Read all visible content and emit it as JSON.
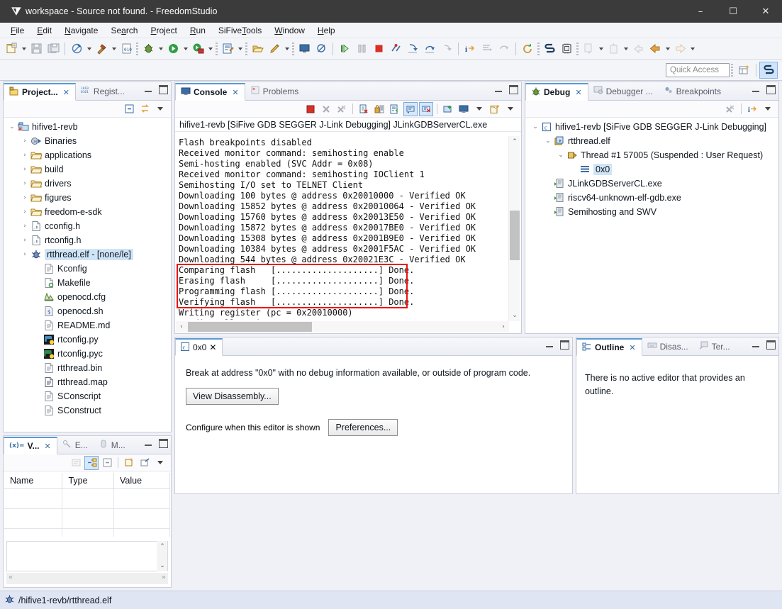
{
  "window": {
    "title": "workspace - Source not found. - FreedomStudio",
    "app_icon": "freedomstudio-logo-icon",
    "minimize": "–",
    "maximize": "☐",
    "close": "✕"
  },
  "menubar": [
    {
      "label": "File",
      "mnemonic": "F"
    },
    {
      "label": "Edit",
      "mnemonic": "E"
    },
    {
      "label": "Navigate",
      "mnemonic": "N"
    },
    {
      "label": "Search",
      "mnemonic": "a"
    },
    {
      "label": "Project",
      "mnemonic": "P"
    },
    {
      "label": "Run",
      "mnemonic": "R"
    },
    {
      "label": "SiFiveTools",
      "mnemonic": "T"
    },
    {
      "label": "Window",
      "mnemonic": "W"
    },
    {
      "label": "Help",
      "mnemonic": "H"
    }
  ],
  "quick_access": {
    "placeholder": "Quick Access",
    "open_perspective_icon": "open-perspective-icon",
    "perspective_icon": "freedomstudio-perspective-icon"
  },
  "project_view": {
    "tabs": [
      {
        "label": "Project...",
        "icon": "project-explorer-icon",
        "active": true,
        "close": "✕"
      },
      {
        "label": "Regist...",
        "icon": "registers-icon",
        "active": false
      }
    ],
    "toolbar": [
      "collapse-all-icon",
      "link-with-editor-icon",
      "view-menu-icon"
    ],
    "tree": [
      {
        "indent": 0,
        "twist": "⌄",
        "icon": "c-project-icon",
        "label": "hifive1-revb",
        "selected": false
      },
      {
        "indent": 1,
        "twist": "›",
        "icon": "binaries-icon",
        "label": "Binaries",
        "selected": false
      },
      {
        "indent": 1,
        "twist": "›",
        "icon": "folder-icon",
        "label": "applications",
        "selected": false
      },
      {
        "indent": 1,
        "twist": "›",
        "icon": "folder-icon",
        "label": "build",
        "selected": false
      },
      {
        "indent": 1,
        "twist": "›",
        "icon": "folder-icon",
        "label": "drivers",
        "selected": false
      },
      {
        "indent": 1,
        "twist": "›",
        "icon": "folder-icon",
        "label": "figures",
        "selected": false
      },
      {
        "indent": 1,
        "twist": "›",
        "icon": "folder-icon",
        "label": "freedom-e-sdk",
        "selected": false
      },
      {
        "indent": 1,
        "twist": "›",
        "icon": "header-file-icon",
        "label": "cconfig.h",
        "selected": false
      },
      {
        "indent": 1,
        "twist": "›",
        "icon": "header-file-icon",
        "label": "rtconfig.h",
        "selected": false
      },
      {
        "indent": 1,
        "twist": "›",
        "icon": "executable-icon",
        "label": "rtthread.elf - [none/le]",
        "selected": true
      },
      {
        "indent": 2,
        "twist": "",
        "icon": "file-icon",
        "label": "Kconfig",
        "selected": false
      },
      {
        "indent": 2,
        "twist": "",
        "icon": "makefile-icon",
        "label": "Makefile",
        "selected": false
      },
      {
        "indent": 2,
        "twist": "",
        "icon": "cfg-file-icon",
        "label": "openocd.cfg",
        "selected": false
      },
      {
        "indent": 2,
        "twist": "",
        "icon": "shell-script-icon",
        "label": "openocd.sh",
        "selected": false
      },
      {
        "indent": 2,
        "twist": "",
        "icon": "file-icon",
        "label": "README.md",
        "selected": false
      },
      {
        "indent": 2,
        "twist": "",
        "icon": "python-file-icon",
        "label": "rtconfig.py",
        "selected": false
      },
      {
        "indent": 2,
        "twist": "",
        "icon": "python-compiled-icon",
        "label": "rtconfig.pyc",
        "selected": false
      },
      {
        "indent": 2,
        "twist": "",
        "icon": "file-icon",
        "label": "rtthread.bin",
        "selected": false
      },
      {
        "indent": 2,
        "twist": "",
        "icon": "map-file-icon",
        "label": "rtthread.map",
        "selected": false
      },
      {
        "indent": 2,
        "twist": "",
        "icon": "file-icon",
        "label": "SConscript",
        "selected": false
      },
      {
        "indent": 2,
        "twist": "",
        "icon": "file-icon",
        "label": "SConstruct",
        "selected": false
      }
    ]
  },
  "variables_view": {
    "tabs": [
      {
        "label": "V...",
        "icon": "variables-icon",
        "active": true,
        "close": "✕"
      },
      {
        "label": "E...",
        "icon": "expressions-icon",
        "active": false
      },
      {
        "label": "M...",
        "icon": "memory-icon",
        "active": false
      }
    ],
    "toolbar": [
      "show-type-names-icon",
      "show-logical-structure-icon",
      "collapse-all-icon",
      "new-variable-icon",
      "new-watch-icon",
      "view-menu-icon"
    ],
    "columns": [
      "Name",
      "Type",
      "Value"
    ],
    "rows": [
      [
        "",
        "",
        ""
      ],
      [
        "",
        "",
        ""
      ],
      [
        "",
        "",
        ""
      ]
    ]
  },
  "console_view": {
    "tabs": [
      {
        "label": "Console",
        "icon": "console-icon",
        "active": true,
        "close": "✕"
      },
      {
        "label": "Problems",
        "icon": "problems-icon",
        "active": false
      }
    ],
    "toolbar": [
      "terminate-icon",
      "remove-launch-icon",
      "remove-all-terminated-icon",
      "clear-console-icon",
      "scroll-lock-icon",
      "word-wrap-icon",
      "show-console-on-output-icon",
      "show-console-on-error-icon",
      "pin-console-icon",
      "display-selected-console-icon",
      "display-selected-console-menu-icon",
      "open-console-icon",
      "open-console-menu-icon"
    ],
    "title": "hifive1-revb [SiFive GDB SEGGER J-Link Debugging] JLinkGDBServerCL.exe",
    "lines": [
      "Flash breakpoints disabled",
      "Received monitor command: semihosting enable",
      "Semi-hosting enabled (SVC Addr = 0x08)",
      "Received monitor command: semihosting IOClient 1",
      "Semihosting I/O set to TELNET Client",
      "Downloading 100 bytes @ address 0x20010000 - Verified OK",
      "Downloading 15852 bytes @ address 0x20010064 - Verified OK",
      "Downloading 15760 bytes @ address 0x20013E50 - Verified OK",
      "Downloading 15872 bytes @ address 0x20017BE0 - Verified OK",
      "Downloading 15308 bytes @ address 0x2001B9E0 - Verified OK",
      "Downloading 10384 bytes @ address 0x2001F5AC - Verified OK",
      "Downloading 544 bytes @ address 0x20021E3C - Verified OK",
      "Comparing flash   [....................] Done.",
      "Erasing flash     [....................] Done.",
      "Programming flash [....................] Done.",
      "Verifying flash   [....................] Done.",
      "Writing register (pc = 0x20010000)",
      "Reading all registers"
    ],
    "highlight": {
      "color": "#ee1111",
      "first_line_index": 12,
      "line_count": 4
    }
  },
  "debug_view": {
    "tabs": [
      {
        "label": "Debug",
        "icon": "debug-icon",
        "active": true,
        "close": "✕"
      },
      {
        "label": "Debugger ...",
        "icon": "debugger-console-icon",
        "active": false
      },
      {
        "label": "Breakpoints",
        "icon": "breakpoints-icon",
        "active": false
      }
    ],
    "toolbar": [
      "remove-all-terminated-icon",
      "show-debug-toolbar-icon",
      "view-menu-icon"
    ],
    "tree": [
      {
        "indent": 0,
        "twist": "⌄",
        "icon": "launch-config-icon",
        "label": "hifive1-revb [SiFive GDB SEGGER J-Link Debugging]",
        "selected": false
      },
      {
        "indent": 1,
        "twist": "⌄",
        "icon": "process-icon",
        "label": "rtthread.elf",
        "selected": false
      },
      {
        "indent": 2,
        "twist": "⌄",
        "icon": "thread-icon",
        "label": "Thread #1 57005 (Suspended : User Request)",
        "selected": false
      },
      {
        "indent": 3,
        "twist": "",
        "icon": "stack-frame-icon",
        "label": "0x0",
        "selected": true
      },
      {
        "indent": 1,
        "twist": "",
        "icon": "system-process-icon",
        "label": "JLinkGDBServerCL.exe",
        "selected": false
      },
      {
        "indent": 1,
        "twist": "",
        "icon": "system-process-icon",
        "label": "riscv64-unknown-elf-gdb.exe",
        "selected": false
      },
      {
        "indent": 1,
        "twist": "",
        "icon": "system-process-icon",
        "label": "Semihosting and SWV",
        "selected": false
      }
    ]
  },
  "editor_area": {
    "tab": {
      "label": "0x0",
      "icon": "c-source-icon",
      "close": "✕"
    },
    "message": "Break at address \"0x0\" with no debug information available, or outside of program code.",
    "view_disassembly_button": "View Disassembly...",
    "configure_label": "Configure when this editor is shown",
    "preferences_button": "Preferences..."
  },
  "outline_view": {
    "tabs": [
      {
        "label": "Outline",
        "icon": "outline-icon",
        "active": true,
        "close": "✕"
      },
      {
        "label": "Disas...",
        "icon": "disassembly-icon",
        "active": false
      },
      {
        "label": "Ter...",
        "icon": "terminal-icon",
        "active": false
      }
    ],
    "message": "There is no active editor that provides an outline."
  },
  "statusbar": {
    "icon": "executable-icon",
    "text": "/hifive1-revb/rtthread.elf"
  },
  "colors": {
    "titlebar_bg": "#3b3b3b",
    "chrome_bg": "#f4f5f9",
    "accent_tab": "#5a9bd6",
    "selection": "#cfe4f7",
    "statusbar_bg": "#dfe5f3",
    "highlight_red": "#ee1111"
  }
}
